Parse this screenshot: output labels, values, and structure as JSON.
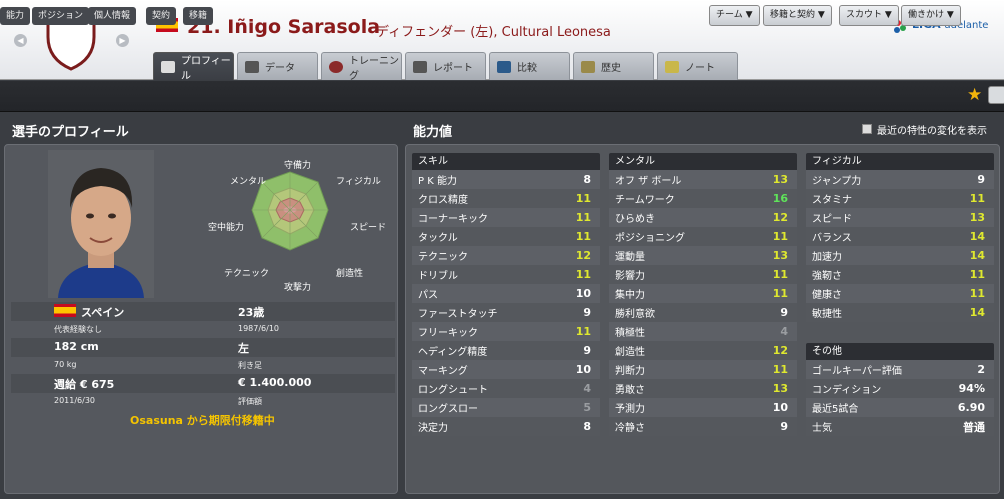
{
  "header": {
    "player_name": "21. Iñigo Sarasola",
    "subtitle": "ディフェンダー (左), Cultural Leonesa",
    "league_logo_main": "LIGA",
    "league_logo_sub": "adelante",
    "club_color": "#7a1c1c",
    "flag_colors": [
      "#c60b1e",
      "#ffc400"
    ]
  },
  "tabs": [
    {
      "label": "プロフィール",
      "icon": "profile-icon",
      "active": true
    },
    {
      "label": "データ",
      "icon": "stats-icon"
    },
    {
      "label": "トレーニング",
      "icon": "ball-icon"
    },
    {
      "label": "レポート",
      "icon": "report-icon"
    },
    {
      "label": "比較",
      "icon": "compare-icon"
    },
    {
      "label": "歴史",
      "icon": "history-icon"
    },
    {
      "label": "ノート",
      "icon": "note-icon"
    }
  ],
  "subnav": {
    "items": [
      "能力",
      "ポジション",
      "個人情報",
      "契約",
      "移籍"
    ]
  },
  "toolbar": {
    "team": "チーム",
    "transfer": "移籍と契約",
    "scout": "スカウト",
    "approach": "働きかけ"
  },
  "profile": {
    "heading": "選手のプロフィール",
    "radar_labels": {
      "top": "守備力",
      "top_right": "フィジカル",
      "right": "スピード",
      "bottom_right": "創造性",
      "bottom": "攻撃力",
      "bottom_left": "テクニック",
      "left": "空中能力",
      "top_left": "メンタル"
    },
    "nationality": "スペイン",
    "age": "23歳",
    "intl": "代表経験なし",
    "dob": "1987/6/10",
    "height": "182 cm",
    "foot": "左",
    "weight": "70 kg",
    "foot_label": "利き足",
    "wage": "週給 € 675",
    "value": "€ 1.400.000",
    "contract": "2011/6/30",
    "value_label": "評価額",
    "loan": "Osasuna から期限付移籍中"
  },
  "attrs": {
    "heading": "能力値",
    "checkbox_label": "最近の特性の変化を表示",
    "skill": {
      "title": "スキル",
      "rows": [
        {
          "name": "P K 能力",
          "v": "8",
          "c": "w"
        },
        {
          "name": "クロス精度",
          "v": "11",
          "c": "g"
        },
        {
          "name": "コーナーキック",
          "v": "11",
          "c": "g"
        },
        {
          "name": "タックル",
          "v": "11",
          "c": "g"
        },
        {
          "name": "テクニック",
          "v": "12",
          "c": "g"
        },
        {
          "name": "ドリブル",
          "v": "11",
          "c": "g"
        },
        {
          "name": "パス",
          "v": "10",
          "c": "w"
        },
        {
          "name": "ファーストタッチ",
          "v": "9",
          "c": "w"
        },
        {
          "name": "フリーキック",
          "v": "11",
          "c": "g"
        },
        {
          "name": "ヘディング精度",
          "v": "9",
          "c": "w"
        },
        {
          "name": "マーキング",
          "v": "10",
          "c": "w"
        },
        {
          "name": "ロングシュート",
          "v": "4",
          "c": "d"
        },
        {
          "name": "ロングスロー",
          "v": "5",
          "c": "d"
        },
        {
          "name": "決定力",
          "v": "8",
          "c": "w"
        }
      ]
    },
    "mental": {
      "title": "メンタル",
      "rows": [
        {
          "name": "オフ ザ ボール",
          "v": "13",
          "c": "g"
        },
        {
          "name": "チームワーク",
          "v": "16",
          "c": "b"
        },
        {
          "name": "ひらめき",
          "v": "12",
          "c": "g"
        },
        {
          "name": "ポジショニング",
          "v": "11",
          "c": "g"
        },
        {
          "name": "運動量",
          "v": "13",
          "c": "g"
        },
        {
          "name": "影響力",
          "v": "11",
          "c": "g"
        },
        {
          "name": "集中力",
          "v": "11",
          "c": "g"
        },
        {
          "name": "勝利意欲",
          "v": "9",
          "c": "w"
        },
        {
          "name": "積極性",
          "v": "4",
          "c": "d"
        },
        {
          "name": "創造性",
          "v": "12",
          "c": "g"
        },
        {
          "name": "判断力",
          "v": "11",
          "c": "g"
        },
        {
          "name": "勇敢さ",
          "v": "13",
          "c": "g"
        },
        {
          "name": "予測力",
          "v": "10",
          "c": "w"
        },
        {
          "name": "冷静さ",
          "v": "9",
          "c": "w"
        }
      ]
    },
    "physical": {
      "title": "フィジカル",
      "rows": [
        {
          "name": "ジャンプ力",
          "v": "9",
          "c": "w"
        },
        {
          "name": "スタミナ",
          "v": "11",
          "c": "g"
        },
        {
          "name": "スピード",
          "v": "13",
          "c": "g"
        },
        {
          "name": "バランス",
          "v": "14",
          "c": "g"
        },
        {
          "name": "加速力",
          "v": "14",
          "c": "g"
        },
        {
          "name": "強靭さ",
          "v": "11",
          "c": "g"
        },
        {
          "name": "健康さ",
          "v": "11",
          "c": "g"
        },
        {
          "name": "敏捷性",
          "v": "14",
          "c": "g"
        }
      ]
    },
    "other": {
      "title": "その他",
      "rows": [
        {
          "name": "ゴールキーパー評価",
          "v": "2",
          "c": "w"
        },
        {
          "name": "コンディション",
          "v": "94%",
          "c": "w"
        },
        {
          "name": "最近5試合",
          "v": "6.90",
          "c": "w"
        },
        {
          "name": "士気",
          "v": "普通",
          "c": "w"
        }
      ]
    }
  }
}
